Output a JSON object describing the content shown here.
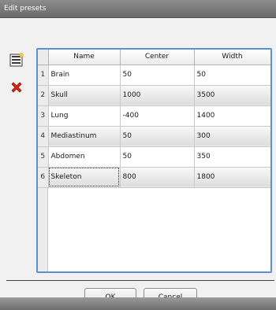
{
  "window": {
    "title": "Edit presets"
  },
  "toolbar": {
    "add_icon": "add-document-icon",
    "remove_icon": "red-x-icon",
    "remove_color": "#d9261c"
  },
  "table": {
    "columns": [
      "Name",
      "Center",
      "Width"
    ],
    "rows": [
      {
        "num": "1",
        "name": "Brain",
        "center": "50",
        "width": "50"
      },
      {
        "num": "2",
        "name": "Skull",
        "center": "1000",
        "width": "3500"
      },
      {
        "num": "3",
        "name": "Lung",
        "center": "-400",
        "width": "1400"
      },
      {
        "num": "4",
        "name": "Mediastinum",
        "center": "50",
        "width": "300"
      },
      {
        "num": "5",
        "name": "Abdomen",
        "center": "50",
        "width": "350"
      },
      {
        "num": "6",
        "name": "Skeleton",
        "center": "800",
        "width": "1800"
      }
    ],
    "frame_color": "#5b8fd6"
  },
  "buttons": {
    "ok_label": "OK",
    "cancel_label": "Cancel"
  }
}
